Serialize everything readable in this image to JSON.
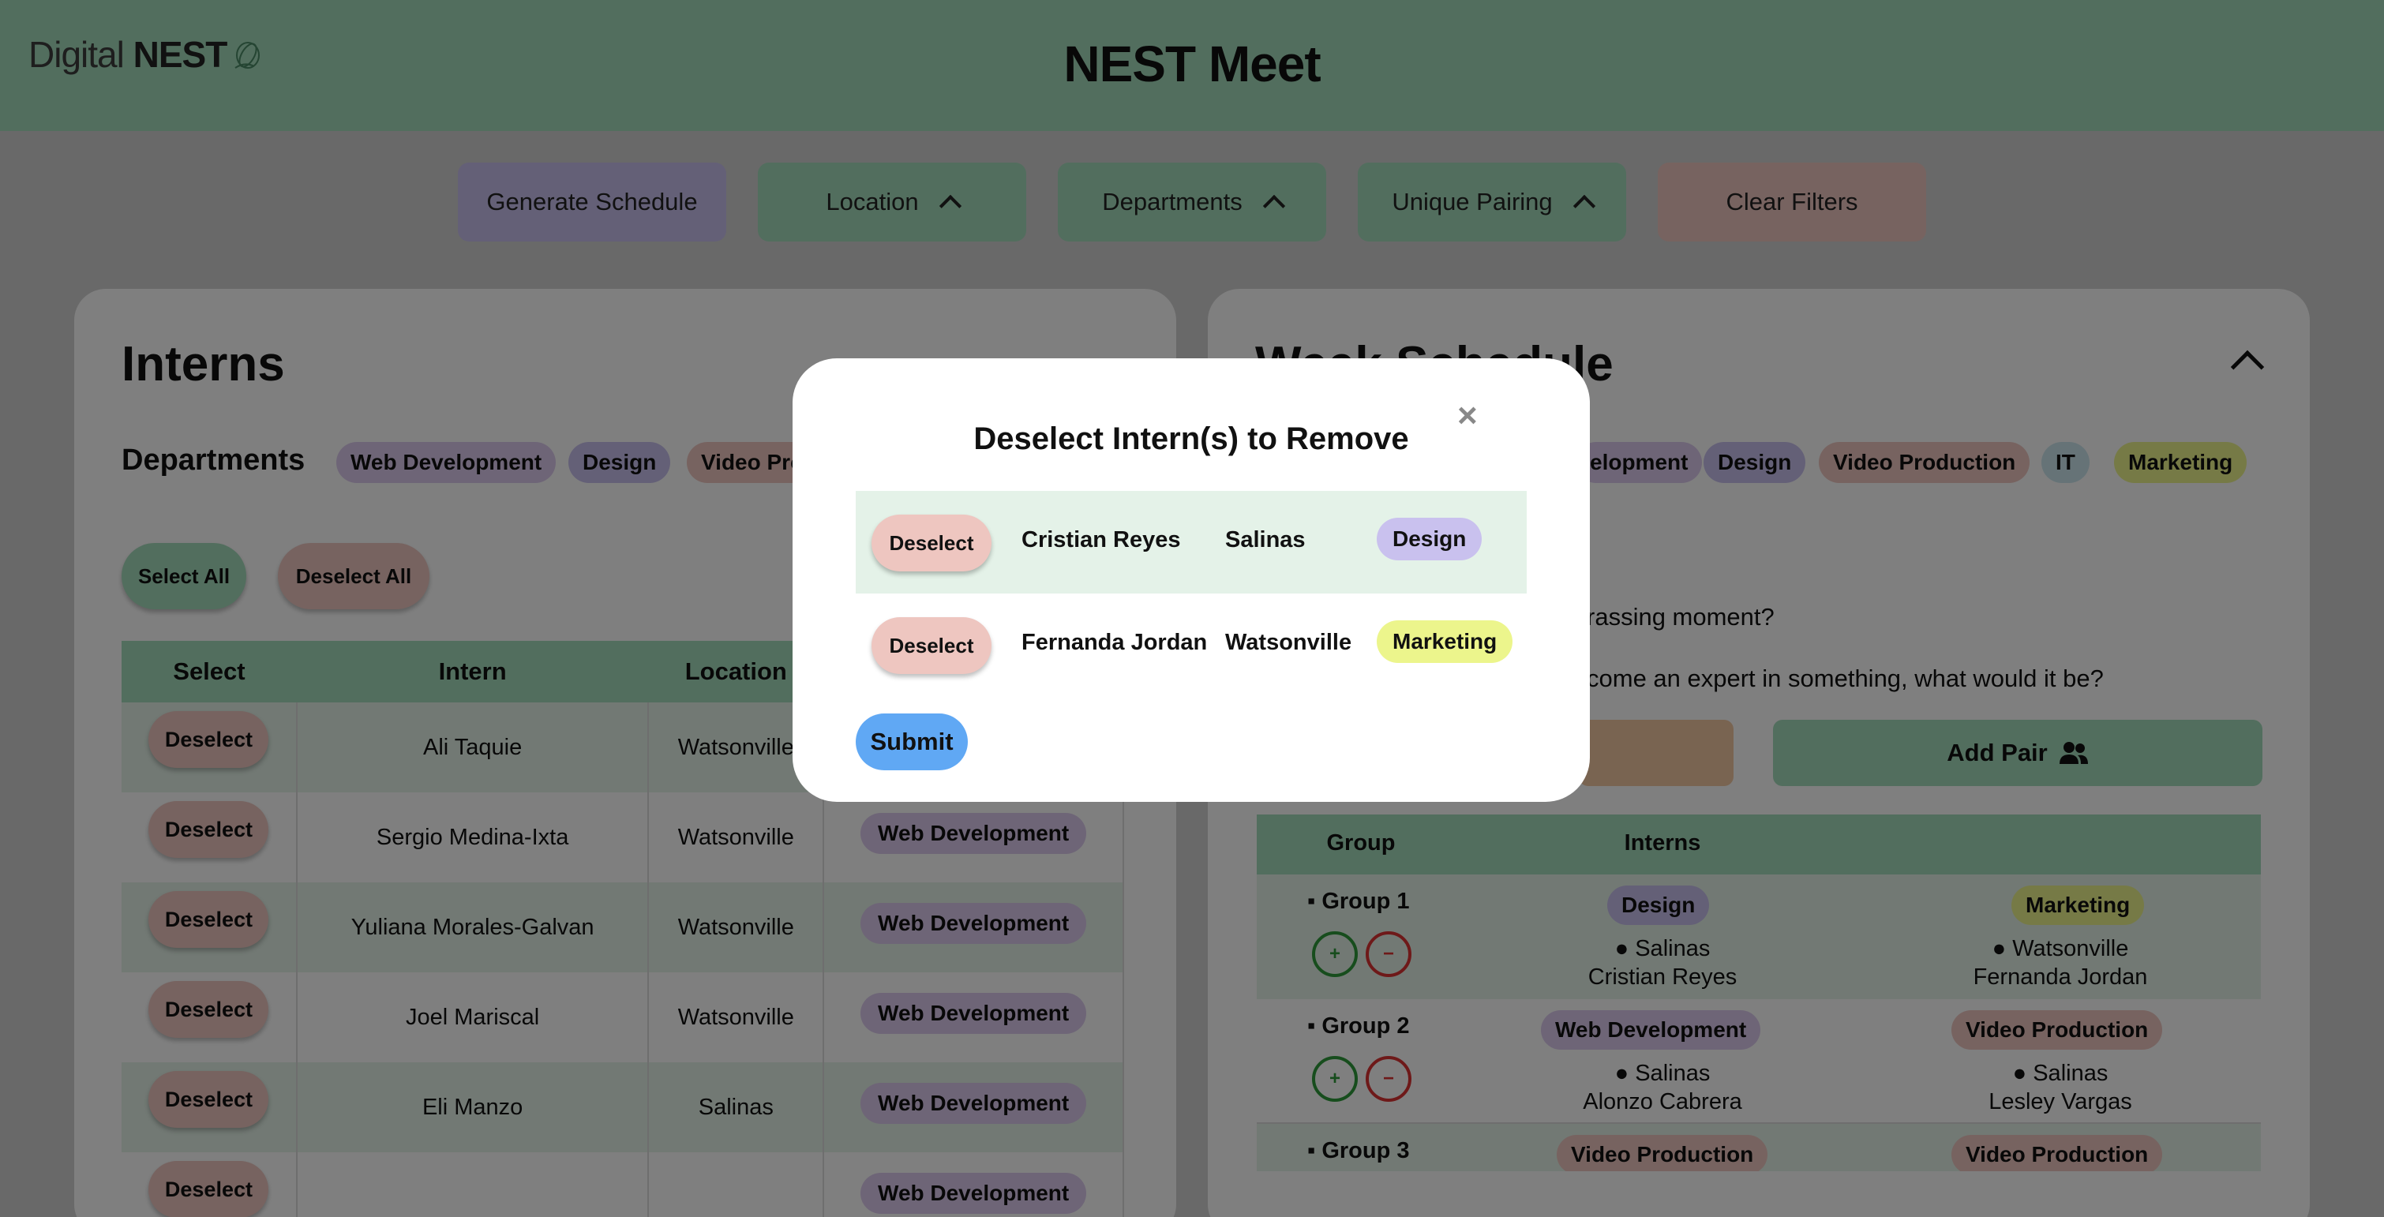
{
  "header": {
    "logo_light": "Digital",
    "logo_bold": "NEST",
    "title": "NEST Meet"
  },
  "toolbar": {
    "generate": "Generate Schedule",
    "location": "Location",
    "departments": "Departments",
    "unique_pairing": "Unique Pairing",
    "clear": "Clear Filters",
    "colors": {
      "generate": "#c9c1ee",
      "filter": "#a4dcbc",
      "clear": "#eec6c0"
    }
  },
  "interns_panel": {
    "title": "Interns",
    "departments_label": "Departments",
    "chips": [
      "Web Development",
      "Design",
      "Video Pro"
    ],
    "select_all": "Select All",
    "deselect_all": "Deselect All",
    "table": {
      "headers": [
        "Select",
        "Intern",
        "Location",
        ""
      ],
      "rows": [
        {
          "button": "Deselect",
          "intern": "Ali Taquie",
          "location": "Watsonville",
          "dept": ""
        },
        {
          "button": "Deselect",
          "intern": "Sergio Medina-Ixta",
          "location": "Watsonville",
          "dept": "Web Development"
        },
        {
          "button": "Deselect",
          "intern": "Yuliana Morales-Galvan",
          "location": "Watsonville",
          "dept": "Web Development"
        },
        {
          "button": "Deselect",
          "intern": "Joel Mariscal",
          "location": "Watsonville",
          "dept": "Web Development"
        },
        {
          "button": "Deselect",
          "intern": "Eli Manzo",
          "location": "Salinas",
          "dept": "Web Development"
        },
        {
          "button": "Deselect",
          "intern": "",
          "location": "",
          "dept": "Web Development"
        }
      ]
    }
  },
  "schedule_panel": {
    "title": "Week Schedule",
    "chips": [
      "elopment",
      "Design",
      "Video Production",
      "IT",
      "Marketing"
    ],
    "question_1": "rassing moment?",
    "question_2": "come an expert in something, what would it be?",
    "add_pair": "Add Pair",
    "groups_table": {
      "headers": [
        "Group",
        "Interns"
      ],
      "groups": [
        {
          "label": "Group 1",
          "a": {
            "dept": "Design",
            "location": "Salinas",
            "name": "Cristian Reyes"
          },
          "b": {
            "dept": "Marketing",
            "location": "Watsonville",
            "name": "Fernanda Jordan"
          }
        },
        {
          "label": "Group 2",
          "a": {
            "dept": "Web Development",
            "location": "Salinas",
            "name": "Alonzo Cabrera"
          },
          "b": {
            "dept": "Video Production",
            "location": "Salinas",
            "name": "Lesley Vargas"
          }
        },
        {
          "label": "Group 3",
          "a": {
            "dept": "Video Production",
            "location": "",
            "name": ""
          },
          "b": {
            "dept": "Video Production",
            "location": "",
            "name": ""
          }
        }
      ]
    }
  },
  "modal": {
    "title": "Deselect Intern(s) to Remove",
    "close": "×",
    "rows": [
      {
        "button": "Deselect",
        "name": "Cristian Reyes",
        "location": "Salinas",
        "dept": "Design"
      },
      {
        "button": "Deselect",
        "name": "Fernanda Jordan",
        "location": "Watsonville",
        "dept": "Marketing"
      }
    ],
    "submit": "Submit"
  }
}
